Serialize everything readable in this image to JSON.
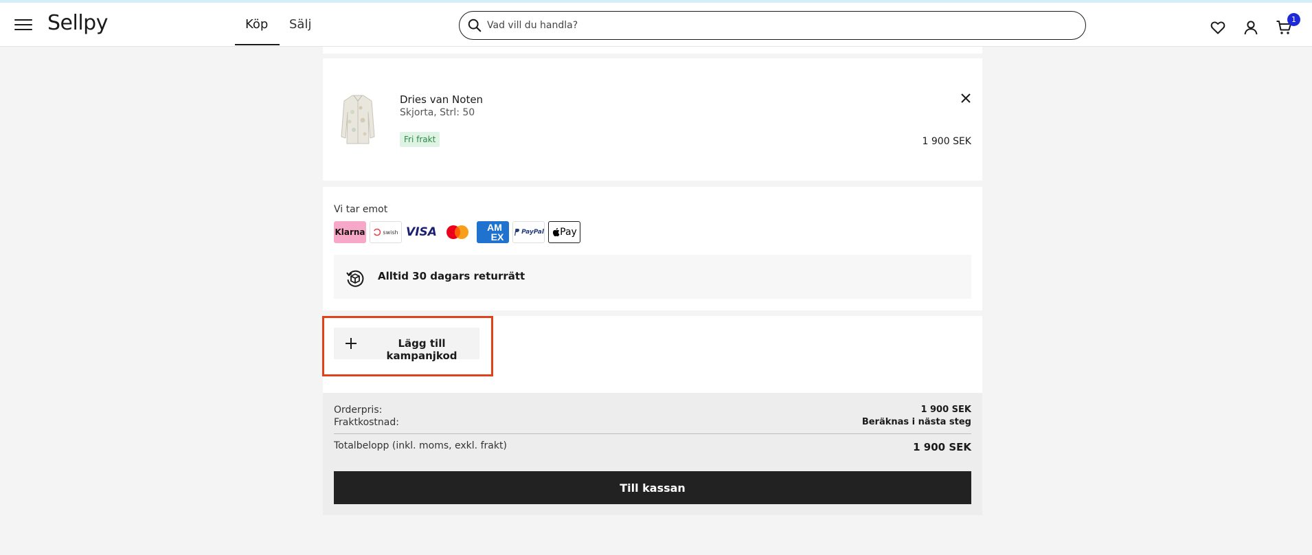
{
  "header": {
    "logo": "Sellpy",
    "tabs": [
      {
        "label": "Köp",
        "active": true
      },
      {
        "label": "Sälj",
        "active": false
      }
    ],
    "search": {
      "placeholder": "Vad vill du handla?",
      "value": ""
    },
    "cart_count": "1",
    "icons": [
      "menu-icon",
      "search-icon",
      "heart-icon",
      "user-icon",
      "cart-icon"
    ]
  },
  "cart_item": {
    "brand": "Dries van Noten",
    "description": "Skjorta, Strl: 50",
    "badge": "Fri frakt",
    "price": "1 900 SEK"
  },
  "payment": {
    "heading": "Vi tar emot",
    "methods": [
      "Klarna",
      "Swish",
      "VISA",
      "Mastercard",
      "American Express",
      "PayPal",
      "Apple Pay"
    ],
    "returns_text": "Alltid 30 dagars returrätt"
  },
  "promo": {
    "label": "Lägg till kampanjkod",
    "highlight_color": "#e1411a"
  },
  "summary": {
    "order_label": "Orderpris:",
    "order_value": "1 900 SEK",
    "shipping_label": "Fraktkostnad:",
    "shipping_value": "Beräknas i nästa steg",
    "total_label": "Totalbelopp (inkl. moms, exkl. frakt)",
    "total_value": "1 900 SEK",
    "checkout_label": "Till kassan"
  },
  "colors": {
    "accent": "#1e2ad8",
    "checkout_bg": "#222222",
    "free_shipping_bg": "#dff3e4",
    "free_shipping_text": "#2e8a47"
  }
}
